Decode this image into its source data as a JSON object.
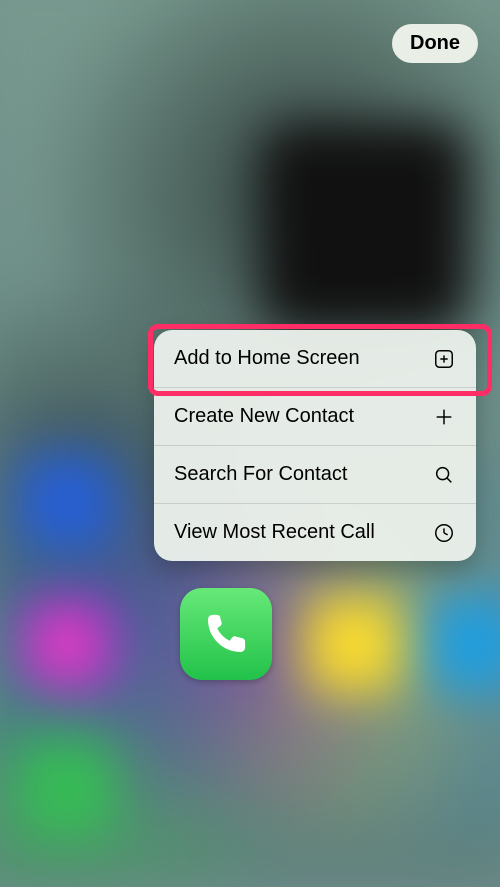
{
  "done_button": {
    "label": "Done"
  },
  "menu": {
    "items": [
      {
        "label": "Add to Home Screen",
        "icon": "plus-box-icon"
      },
      {
        "label": "Create New Contact",
        "icon": "plus-icon"
      },
      {
        "label": "Search For Contact",
        "icon": "search-icon"
      },
      {
        "label": "View Most Recent Call",
        "icon": "clock-icon"
      }
    ],
    "highlighted_index": 0
  },
  "active_app": {
    "name": "Phone",
    "icon": "phone-icon"
  }
}
